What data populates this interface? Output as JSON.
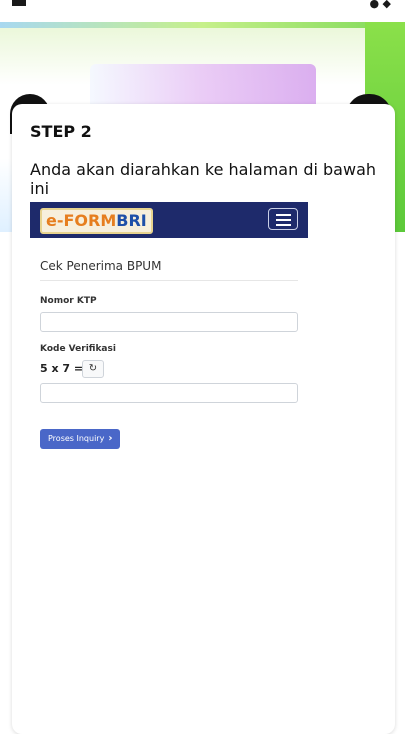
{
  "step": {
    "title": "STEP 2",
    "description": "Anda akan diarahkan ke halaman di bawah ini"
  },
  "embedded_page": {
    "logo": {
      "part1": "e-FORM",
      "part2": "BRI"
    },
    "menu_icon": "hamburger-icon",
    "form_title": "Cek Penerima BPUM",
    "ktp_label": "Nomor KTP",
    "ktp_value": "",
    "kode_label": "Kode Verifikasi",
    "captcha": "5 x 7 =",
    "refresh_icon": "↻",
    "kode_value": "",
    "submit_label": "Proses Inquiry",
    "submit_icon": "›"
  },
  "colors": {
    "nav_bg": "#1e2a6b",
    "button_bg": "#4a67c8",
    "logo_orange": "#e67e1f",
    "logo_blue": "#1e4fa8"
  }
}
